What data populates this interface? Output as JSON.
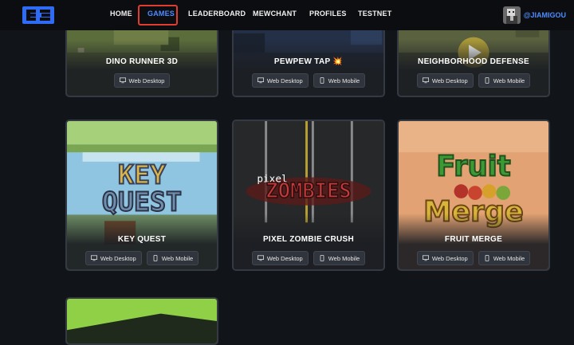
{
  "nav": {
    "items": [
      {
        "label": "HOME",
        "active": false
      },
      {
        "label": "GAMES",
        "active": true
      },
      {
        "label": "LEADERBOARD",
        "active": false
      },
      {
        "label": "MEWCHANT",
        "active": false
      },
      {
        "label": "PROFILES",
        "active": false
      },
      {
        "label": "TESTNET",
        "active": false
      }
    ],
    "user": "@JIAMIGOU",
    "accent": "#4c8dff",
    "highlight_color": "#e03c2f"
  },
  "games": [
    {
      "title": "DINO RUNNER 3D",
      "platforms": [
        "Web Desktop"
      ]
    },
    {
      "title": "PEWPEW TAP 💥",
      "platforms": [
        "Web Desktop",
        "Web Mobile"
      ]
    },
    {
      "title": "NEIGHBORHOOD DEFENSE",
      "platforms": [
        "Web Desktop",
        "Web Mobile"
      ]
    },
    {
      "title": "KEY QUEST",
      "art_text": [
        "KEY",
        "QUEST"
      ],
      "platforms": [
        "Web Desktop",
        "Web Mobile"
      ]
    },
    {
      "title": "PIXEL ZOMBIE CRUSH",
      "art_text": [
        "pixel",
        "ZOMBIES"
      ],
      "platforms": [
        "Web Desktop",
        "Web Mobile"
      ]
    },
    {
      "title": "FRUIT MERGE",
      "art_text": [
        "Fruit",
        "Merge"
      ],
      "platforms": [
        "Web Desktop",
        "Web Mobile"
      ]
    }
  ],
  "icons": {
    "desktop": "monitor-icon",
    "mobile": "phone-icon"
  }
}
